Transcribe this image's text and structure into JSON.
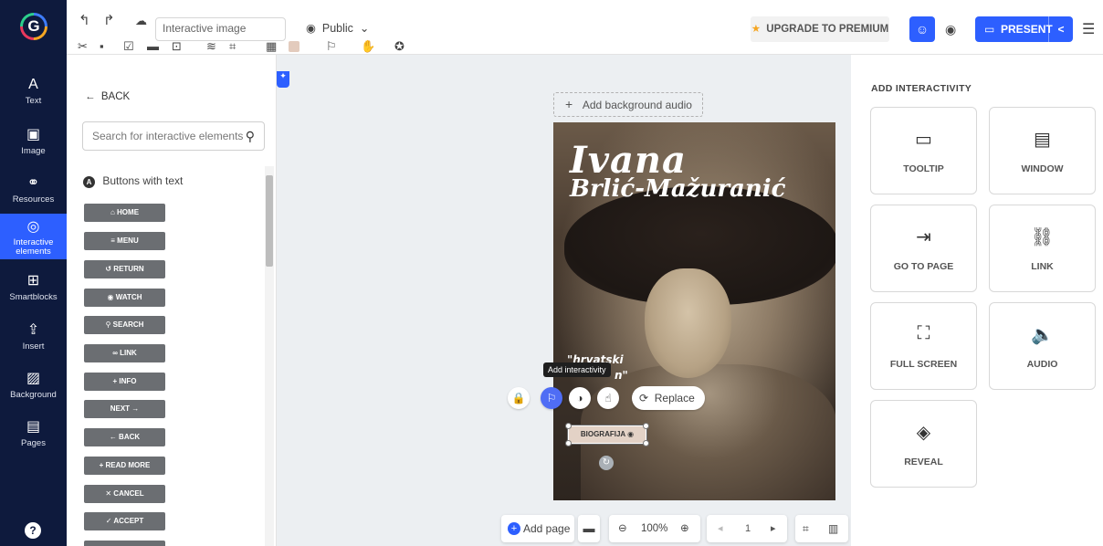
{
  "rail": {
    "items": [
      {
        "label": "Text",
        "icon": "A"
      },
      {
        "label": "Image",
        "icon": "▣"
      },
      {
        "label": "Resources",
        "icon": "⚭"
      },
      {
        "label": "Interactive elements",
        "icon": "◎"
      },
      {
        "label": "Smartblocks",
        "icon": "⊞"
      },
      {
        "label": "Insert",
        "icon": "⇪"
      },
      {
        "label": "Background",
        "icon": "▨"
      },
      {
        "label": "Pages",
        "icon": "▤"
      }
    ],
    "help": "?"
  },
  "toolbar": {
    "title_value": "Interactive image",
    "visibility": "Public",
    "upgrade": "UPGRADE TO PREMIUM",
    "present": "PRESENT"
  },
  "sidepanel": {
    "back": "BACK",
    "search_placeholder": "Search for interactive elements",
    "section": "Buttons with text",
    "buttons": [
      "HOME",
      "MENU",
      "RETURN",
      "WATCH",
      "SEARCH",
      "LINK",
      "+ INFO",
      "NEXT →",
      "← BACK",
      "+ READ MORE",
      "✕ CANCEL",
      "✓ ACCEPT"
    ]
  },
  "canvas": {
    "add_audio": "Add background audio",
    "title_line1": "Ivana",
    "title_line2": "Brlić-Mažuranić",
    "quote_line1": "\"hrvatski",
    "quote_line2": "n\"",
    "tooltip": "Add interactivity",
    "replace": "Replace",
    "bio_button": "BIOGRAFIJA"
  },
  "bottombar": {
    "add_page": "Add page",
    "zoom": "100%",
    "page_number": "1"
  },
  "rightpanel": {
    "title": "ADD INTERACTIVITY",
    "cards": [
      {
        "label": "TOOLTIP",
        "icon": "tooltip-icon"
      },
      {
        "label": "WINDOW",
        "icon": "window-icon"
      },
      {
        "label": "GO TO PAGE",
        "icon": "go-to-page-icon"
      },
      {
        "label": "LINK",
        "icon": "link-icon"
      },
      {
        "label": "FULL SCREEN",
        "icon": "full-screen-icon"
      },
      {
        "label": "AUDIO",
        "icon": "audio-icon"
      },
      {
        "label": "REVEAL",
        "icon": "reveal-icon"
      }
    ]
  },
  "colors": {
    "rail_bg": "#0e1a3d",
    "accent": "#2d5fff"
  }
}
